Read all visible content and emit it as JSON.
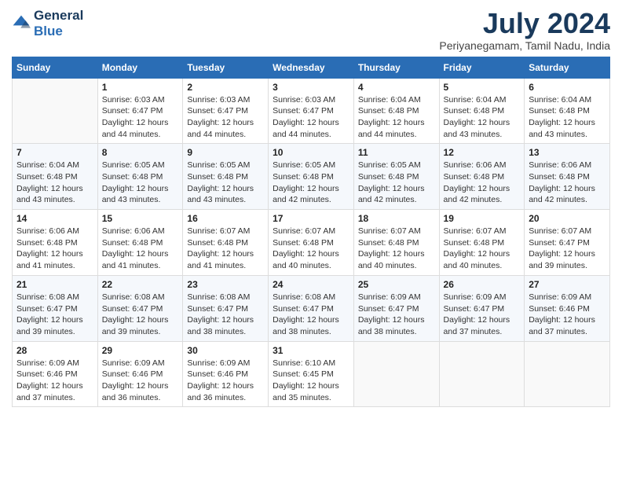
{
  "logo": {
    "line1": "General",
    "line2": "Blue"
  },
  "title": "July 2024",
  "location": "Periyanegamam, Tamil Nadu, India",
  "days_of_week": [
    "Sunday",
    "Monday",
    "Tuesday",
    "Wednesday",
    "Thursday",
    "Friday",
    "Saturday"
  ],
  "weeks": [
    [
      {
        "day": "",
        "info": ""
      },
      {
        "day": "1",
        "info": "Sunrise: 6:03 AM\nSunset: 6:47 PM\nDaylight: 12 hours\nand 44 minutes."
      },
      {
        "day": "2",
        "info": "Sunrise: 6:03 AM\nSunset: 6:47 PM\nDaylight: 12 hours\nand 44 minutes."
      },
      {
        "day": "3",
        "info": "Sunrise: 6:03 AM\nSunset: 6:47 PM\nDaylight: 12 hours\nand 44 minutes."
      },
      {
        "day": "4",
        "info": "Sunrise: 6:04 AM\nSunset: 6:48 PM\nDaylight: 12 hours\nand 44 minutes."
      },
      {
        "day": "5",
        "info": "Sunrise: 6:04 AM\nSunset: 6:48 PM\nDaylight: 12 hours\nand 43 minutes."
      },
      {
        "day": "6",
        "info": "Sunrise: 6:04 AM\nSunset: 6:48 PM\nDaylight: 12 hours\nand 43 minutes."
      }
    ],
    [
      {
        "day": "7",
        "info": "Sunrise: 6:04 AM\nSunset: 6:48 PM\nDaylight: 12 hours\nand 43 minutes."
      },
      {
        "day": "8",
        "info": "Sunrise: 6:05 AM\nSunset: 6:48 PM\nDaylight: 12 hours\nand 43 minutes."
      },
      {
        "day": "9",
        "info": "Sunrise: 6:05 AM\nSunset: 6:48 PM\nDaylight: 12 hours\nand 43 minutes."
      },
      {
        "day": "10",
        "info": "Sunrise: 6:05 AM\nSunset: 6:48 PM\nDaylight: 12 hours\nand 42 minutes."
      },
      {
        "day": "11",
        "info": "Sunrise: 6:05 AM\nSunset: 6:48 PM\nDaylight: 12 hours\nand 42 minutes."
      },
      {
        "day": "12",
        "info": "Sunrise: 6:06 AM\nSunset: 6:48 PM\nDaylight: 12 hours\nand 42 minutes."
      },
      {
        "day": "13",
        "info": "Sunrise: 6:06 AM\nSunset: 6:48 PM\nDaylight: 12 hours\nand 42 minutes."
      }
    ],
    [
      {
        "day": "14",
        "info": "Sunrise: 6:06 AM\nSunset: 6:48 PM\nDaylight: 12 hours\nand 41 minutes."
      },
      {
        "day": "15",
        "info": "Sunrise: 6:06 AM\nSunset: 6:48 PM\nDaylight: 12 hours\nand 41 minutes."
      },
      {
        "day": "16",
        "info": "Sunrise: 6:07 AM\nSunset: 6:48 PM\nDaylight: 12 hours\nand 41 minutes."
      },
      {
        "day": "17",
        "info": "Sunrise: 6:07 AM\nSunset: 6:48 PM\nDaylight: 12 hours\nand 40 minutes."
      },
      {
        "day": "18",
        "info": "Sunrise: 6:07 AM\nSunset: 6:48 PM\nDaylight: 12 hours\nand 40 minutes."
      },
      {
        "day": "19",
        "info": "Sunrise: 6:07 AM\nSunset: 6:48 PM\nDaylight: 12 hours\nand 40 minutes."
      },
      {
        "day": "20",
        "info": "Sunrise: 6:07 AM\nSunset: 6:47 PM\nDaylight: 12 hours\nand 39 minutes."
      }
    ],
    [
      {
        "day": "21",
        "info": "Sunrise: 6:08 AM\nSunset: 6:47 PM\nDaylight: 12 hours\nand 39 minutes."
      },
      {
        "day": "22",
        "info": "Sunrise: 6:08 AM\nSunset: 6:47 PM\nDaylight: 12 hours\nand 39 minutes."
      },
      {
        "day": "23",
        "info": "Sunrise: 6:08 AM\nSunset: 6:47 PM\nDaylight: 12 hours\nand 38 minutes."
      },
      {
        "day": "24",
        "info": "Sunrise: 6:08 AM\nSunset: 6:47 PM\nDaylight: 12 hours\nand 38 minutes."
      },
      {
        "day": "25",
        "info": "Sunrise: 6:09 AM\nSunset: 6:47 PM\nDaylight: 12 hours\nand 38 minutes."
      },
      {
        "day": "26",
        "info": "Sunrise: 6:09 AM\nSunset: 6:47 PM\nDaylight: 12 hours\nand 37 minutes."
      },
      {
        "day": "27",
        "info": "Sunrise: 6:09 AM\nSunset: 6:46 PM\nDaylight: 12 hours\nand 37 minutes."
      }
    ],
    [
      {
        "day": "28",
        "info": "Sunrise: 6:09 AM\nSunset: 6:46 PM\nDaylight: 12 hours\nand 37 minutes."
      },
      {
        "day": "29",
        "info": "Sunrise: 6:09 AM\nSunset: 6:46 PM\nDaylight: 12 hours\nand 36 minutes."
      },
      {
        "day": "30",
        "info": "Sunrise: 6:09 AM\nSunset: 6:46 PM\nDaylight: 12 hours\nand 36 minutes."
      },
      {
        "day": "31",
        "info": "Sunrise: 6:10 AM\nSunset: 6:45 PM\nDaylight: 12 hours\nand 35 minutes."
      },
      {
        "day": "",
        "info": ""
      },
      {
        "day": "",
        "info": ""
      },
      {
        "day": "",
        "info": ""
      }
    ]
  ]
}
